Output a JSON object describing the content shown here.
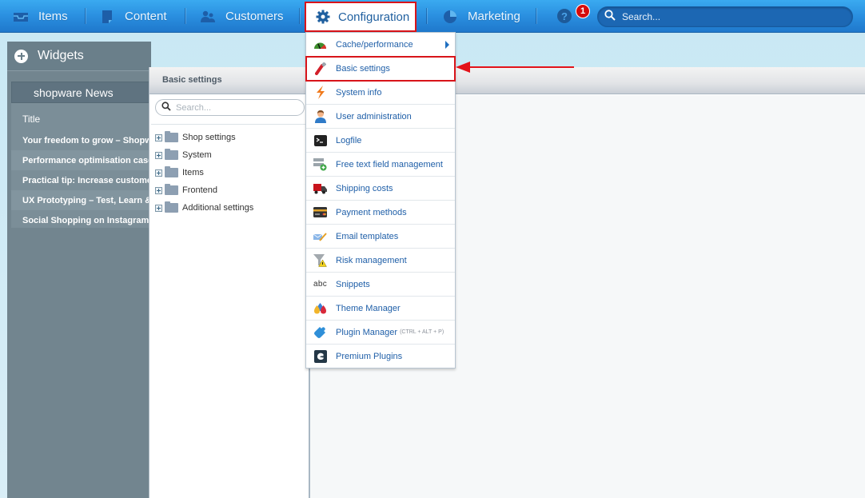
{
  "topnav": {
    "items": [
      {
        "label": "Items",
        "icon": "inbox-icon"
      },
      {
        "label": "Content",
        "icon": "document-icon"
      },
      {
        "label": "Customers",
        "icon": "users-icon"
      },
      {
        "label": "Configuration",
        "icon": "gear-icon",
        "active": true
      },
      {
        "label": "Marketing",
        "icon": "pie-chart-icon"
      }
    ],
    "help_icon": "?",
    "notification_count": "1",
    "search_placeholder": "Search..."
  },
  "widgets": {
    "title": "Widgets",
    "news": {
      "title": "shopware News",
      "column_header": "Title",
      "rows": [
        "Your freedom to grow – Shopware",
        "Performance optimisation case",
        "Practical tip: Increase customer",
        "UX Prototyping – Test, Learn & Iterate",
        "Social Shopping on Instagram"
      ]
    }
  },
  "basic_settings_window": {
    "title": "Basic settings",
    "search_placeholder": "Search...",
    "tree": [
      "Shop settings",
      "System",
      "Items",
      "Frontend",
      "Additional settings"
    ]
  },
  "config_menu": {
    "items": [
      {
        "label": "Cache/performance",
        "icon": "speedometer-icon",
        "submenu": true
      },
      {
        "label": "Basic settings",
        "icon": "wrench-icon",
        "highlighted": true
      },
      {
        "label": "System info",
        "icon": "lightning-icon"
      },
      {
        "label": "User administration",
        "icon": "user-icon"
      },
      {
        "label": "Logfile",
        "icon": "terminal-icon"
      },
      {
        "label": "Free text field management",
        "icon": "add-field-icon"
      },
      {
        "label": "Shipping costs",
        "icon": "truck-icon"
      },
      {
        "label": "Payment methods",
        "icon": "credit-card-icon"
      },
      {
        "label": "Email templates",
        "icon": "email-edit-icon"
      },
      {
        "label": "Risk management",
        "icon": "filter-warning-icon"
      },
      {
        "label": "Snippets",
        "icon": "abc-icon",
        "icon_text": "abc"
      },
      {
        "label": "Theme Manager",
        "icon": "color-drops-icon"
      },
      {
        "label": "Plugin Manager",
        "icon": "puzzle-icon",
        "shortcut": "(CTRL + ALT + P)"
      },
      {
        "label": "Premium Plugins",
        "icon": "shopware-logo-icon"
      }
    ]
  },
  "colors": {
    "topbar": "#2a8fe0",
    "highlight_red": "#d8141a",
    "menu_text": "#1f5fa8",
    "widgets_bg": "#72858f"
  }
}
